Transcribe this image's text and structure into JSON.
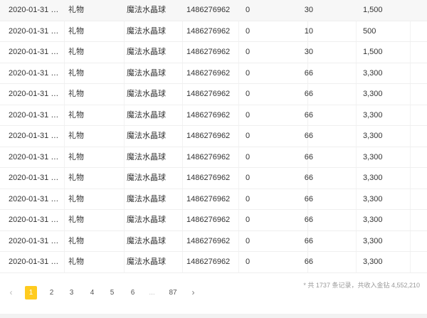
{
  "table": {
    "rows": [
      {
        "time": "2020-01-31 23:...",
        "type": "礼物",
        "item": "魔法水晶球",
        "id": "1486276962",
        "count": "0",
        "qty": "30",
        "value": "1,500"
      },
      {
        "time": "2020-01-31 23:...",
        "type": "礼物",
        "item": "魔法水晶球",
        "id": "1486276962",
        "count": "0",
        "qty": "10",
        "value": "500"
      },
      {
        "time": "2020-01-31 23:...",
        "type": "礼物",
        "item": "魔法水晶球",
        "id": "1486276962",
        "count": "0",
        "qty": "30",
        "value": "1,500"
      },
      {
        "time": "2020-01-31 23:...",
        "type": "礼物",
        "item": "魔法水晶球",
        "id": "1486276962",
        "count": "0",
        "qty": "66",
        "value": "3,300"
      },
      {
        "time": "2020-01-31 23:...",
        "type": "礼物",
        "item": "魔法水晶球",
        "id": "1486276962",
        "count": "0",
        "qty": "66",
        "value": "3,300"
      },
      {
        "time": "2020-01-31 23:...",
        "type": "礼物",
        "item": "魔法水晶球",
        "id": "1486276962",
        "count": "0",
        "qty": "66",
        "value": "3,300"
      },
      {
        "time": "2020-01-31 23:...",
        "type": "礼物",
        "item": "魔法水晶球",
        "id": "1486276962",
        "count": "0",
        "qty": "66",
        "value": "3,300"
      },
      {
        "time": "2020-01-31 23:...",
        "type": "礼物",
        "item": "魔法水晶球",
        "id": "1486276962",
        "count": "0",
        "qty": "66",
        "value": "3,300"
      },
      {
        "time": "2020-01-31 23:...",
        "type": "礼物",
        "item": "魔法水晶球",
        "id": "1486276962",
        "count": "0",
        "qty": "66",
        "value": "3,300"
      },
      {
        "time": "2020-01-31 23:...",
        "type": "礼物",
        "item": "魔法水晶球",
        "id": "1486276962",
        "count": "0",
        "qty": "66",
        "value": "3,300"
      },
      {
        "time": "2020-01-31 23:...",
        "type": "礼物",
        "item": "魔法水晶球",
        "id": "1486276962",
        "count": "0",
        "qty": "66",
        "value": "3,300"
      },
      {
        "time": "2020-01-31 23:...",
        "type": "礼物",
        "item": "魔法水晶球",
        "id": "1486276962",
        "count": "0",
        "qty": "66",
        "value": "3,300"
      },
      {
        "time": "2020-01-31 23:...",
        "type": "礼物",
        "item": "魔法水晶球",
        "id": "1486276962",
        "count": "0",
        "qty": "66",
        "value": "3,300"
      }
    ],
    "highlighted_row": 0
  },
  "summary": "* 共 1737 条记录，共收入金钻 4,552,210",
  "pagination": {
    "prev_icon": "chevron-left-icon",
    "next_icon": "chevron-right-icon",
    "prev": "‹",
    "next": "›",
    "pages": [
      "1",
      "2",
      "3",
      "4",
      "5",
      "6",
      "...",
      "87"
    ],
    "current": "1"
  },
  "colors": {
    "accent": "#ffcb1f",
    "row_highlight": "#f7f7f7",
    "muted_text": "#999999"
  }
}
